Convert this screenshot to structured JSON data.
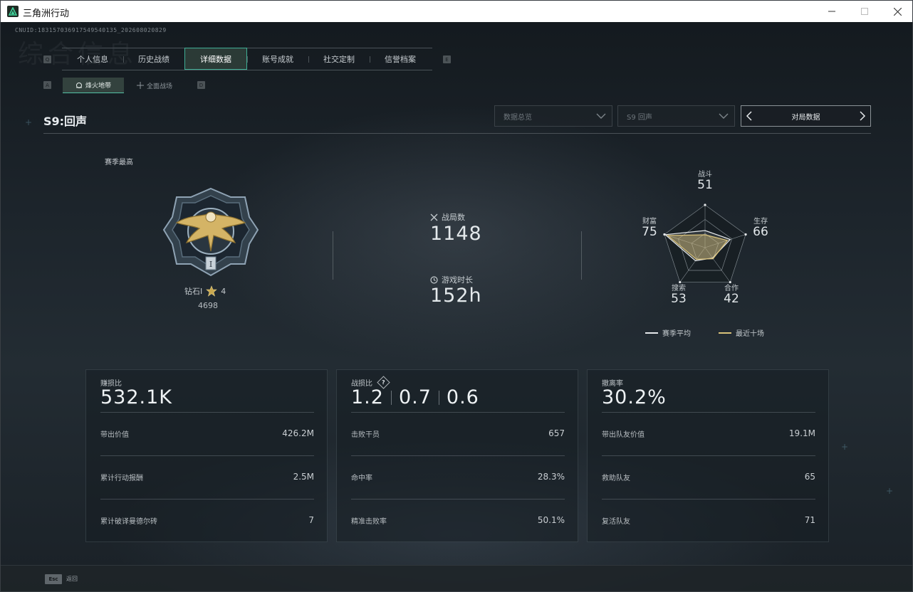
{
  "window": {
    "title": "三角洲行动"
  },
  "uid": "CNUID:183157036917549540135_202608020829",
  "bg_title": "综合信息",
  "tabs": [
    "个人信息",
    "历史战绩",
    "详细数据",
    "账号成就",
    "社交定制",
    "信誉档案"
  ],
  "active_tab": 2,
  "key_hints": {
    "prev_tab": "Q",
    "next_tab": "E",
    "prev_sub": "A",
    "next_sub": "D"
  },
  "subtabs": [
    "烽火地带",
    "全面战场"
  ],
  "season": {
    "title": "S9:回声"
  },
  "filters": {
    "data_type": "数据总览",
    "season": "S9 回声",
    "match_nav": "对局数据"
  },
  "rank": {
    "season_best_label": "赛季最高",
    "tier": "钻石I",
    "stars": "4",
    "score": "4698",
    "medal_numeral": "I"
  },
  "stats": {
    "matches_label": "战局数",
    "matches": "1148",
    "playtime_label": "游戏时长",
    "playtime": "152h"
  },
  "radar": {
    "axes": [
      {
        "label": "战斗",
        "value": "51"
      },
      {
        "label": "生存",
        "value": "66"
      },
      {
        "label": "合作",
        "value": "42"
      },
      {
        "label": "搜索",
        "value": "53"
      },
      {
        "label": "财富",
        "value": "75"
      }
    ],
    "series_avg": [
      0.4,
      0.62,
      0.3,
      0.38,
      0.98
    ],
    "series_recent": [
      0.3,
      0.55,
      0.32,
      0.34,
      0.92
    ],
    "legend_avg": "赛季平均",
    "legend_recent": "最近十场",
    "colors": {
      "avg": "#e6e9eb",
      "recent": "#d9c27a",
      "grid": "#7d868c"
    }
  },
  "cards": [
    {
      "label": "赚损比",
      "big": "532.1K",
      "rows": [
        {
          "k": "带出价值",
          "v": "426.2M"
        },
        {
          "k": "累计行动报酬",
          "v": "2.5M"
        },
        {
          "k": "累计破译曼德尔砖",
          "v": "7"
        }
      ]
    },
    {
      "label": "战损比",
      "big_parts": [
        "1.2",
        "0.7",
        "0.6"
      ],
      "help": "?",
      "rows": [
        {
          "k": "击败干员",
          "v": "657"
        },
        {
          "k": "命中率",
          "v": "28.3%"
        },
        {
          "k": "精准击败率",
          "v": "50.1%"
        }
      ]
    },
    {
      "label": "撤离率",
      "big": "30.2%",
      "rows": [
        {
          "k": "带出队友价值",
          "v": "19.1M"
        },
        {
          "k": "救助队友",
          "v": "65"
        },
        {
          "k": "复活队友",
          "v": "71"
        }
      ]
    }
  ],
  "bottom": {
    "esc_key": "Esc",
    "esc_label": "返回"
  },
  "colors": {
    "accent": "#3fae95",
    "gold": "#d9c27a"
  }
}
